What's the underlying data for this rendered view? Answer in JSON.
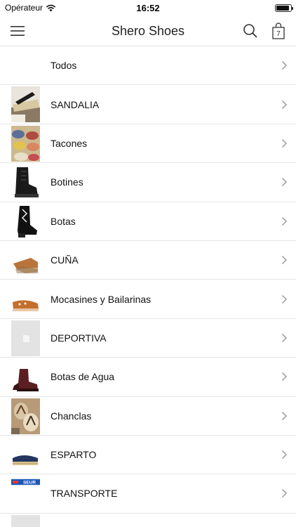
{
  "status": {
    "carrier": "Opérateur",
    "time": "16:52",
    "battery_level": 0.9
  },
  "nav": {
    "title": "Shero Shoes",
    "cart_count": "7",
    "menu_icon": "hamburger-menu-icon",
    "search_icon": "search-icon",
    "cart_icon": "shopping-bag-icon"
  },
  "categories": [
    {
      "label": "Todos",
      "thumb": "none"
    },
    {
      "label": "SANDALIA",
      "thumb": "sandal"
    },
    {
      "label": "Tacones",
      "thumb": "espadrilles"
    },
    {
      "label": "Botines",
      "thumb": "black-boot"
    },
    {
      "label": "Botas",
      "thumb": "cowboy-boot"
    },
    {
      "label": "CUÑA",
      "thumb": "wedge"
    },
    {
      "label": "Mocasines y Bailarinas",
      "thumb": "loafer"
    },
    {
      "label": "DEPORTIVA",
      "thumb": "placeholder"
    },
    {
      "label": "Botas de Agua",
      "thumb": "rain-boot"
    },
    {
      "label": "Chanclas",
      "thumb": "flip-flops"
    },
    {
      "label": "ESPARTO",
      "thumb": "espadrille-navy"
    },
    {
      "label": "TRANSPORTE",
      "thumb": "seur-logo"
    },
    {
      "label": "",
      "thumb": "placeholder"
    }
  ],
  "logo_text": {
    "seur": "SEUR"
  }
}
